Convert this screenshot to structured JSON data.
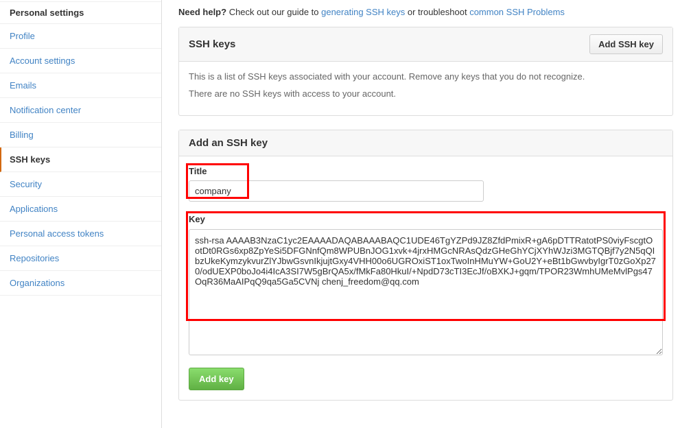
{
  "sidebar": {
    "title": "Personal settings",
    "items": [
      {
        "label": "Profile",
        "active": false
      },
      {
        "label": "Account settings",
        "active": false
      },
      {
        "label": "Emails",
        "active": false
      },
      {
        "label": "Notification center",
        "active": false
      },
      {
        "label": "Billing",
        "active": false
      },
      {
        "label": "SSH keys",
        "active": true
      },
      {
        "label": "Security",
        "active": false
      },
      {
        "label": "Applications",
        "active": false
      },
      {
        "label": "Personal access tokens",
        "active": false
      },
      {
        "label": "Repositories",
        "active": false
      },
      {
        "label": "Organizations",
        "active": false
      }
    ]
  },
  "help": {
    "bold": "Need help?",
    "text1": " Check out our guide to ",
    "link1": "generating SSH keys",
    "text2": " or troubleshoot ",
    "link2": "common SSH Problems"
  },
  "sshkeys_panel": {
    "title": "SSH keys",
    "add_button": "Add SSH key",
    "desc1": "This is a list of SSH keys associated with your account. Remove any keys that you do not recognize.",
    "desc2": "There are no SSH keys with access to your account."
  },
  "add_panel": {
    "title": "Add an SSH key",
    "title_label": "Title",
    "title_value": "company",
    "key_label": "Key",
    "key_value": "ssh-rsa AAAAB3NzaC1yc2EAAAADAQABAAABAQC1UDE46TgYZPd9JZ8ZfdPmixR+gA6pDTTRatotPS0viyFscgtOotDt0RGs6xp8ZpYeSi5DFGNnfQm8WPUBnJOG1xvk+4jrxHMGcNRAsQdzGHeGhYCjXYhWJzi3MGTQBjf7y2N5qQIbzUkeKymzykvurZlYJbwGsvnIkjujtGxy4VHH00o6UGROxiST1oxTwoInHMuYW+GoU2Y+eBt1bGwvbyIgrT0zGoXp270/odUEXP0boJo4i4IcA3SI7W5gBrQA5x/fMkFa80HkuI/+NpdD73cTI3EcJf/oBXKJ+gqm/TPOR23WmhUMeMvlPgs47OqR36MaAIPqQ9qa5Ga5CVNj chenj_freedom@qq.com",
    "submit": "Add key"
  }
}
